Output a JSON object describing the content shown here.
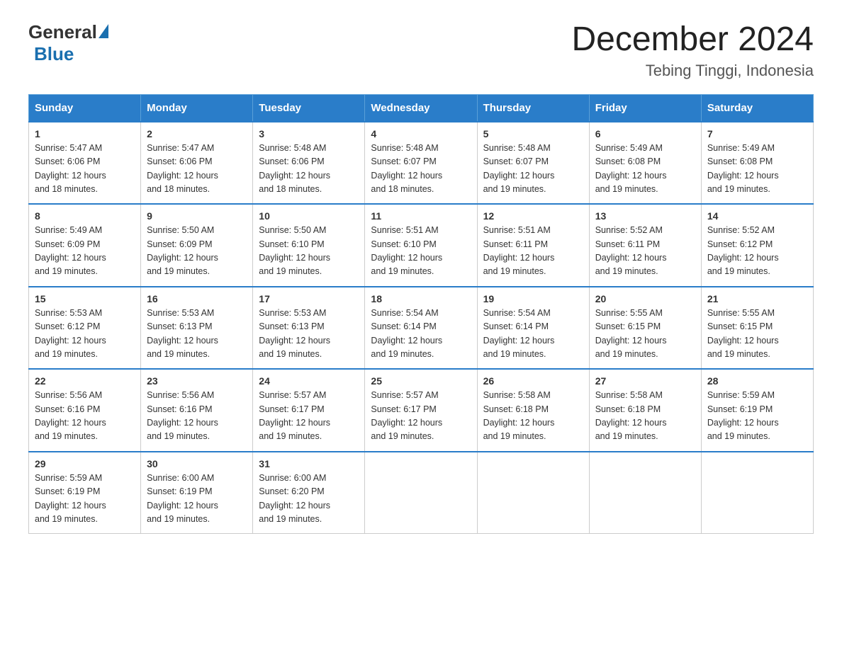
{
  "logo": {
    "general": "General",
    "blue": "Blue"
  },
  "title": "December 2024",
  "subtitle": "Tebing Tinggi, Indonesia",
  "headers": [
    "Sunday",
    "Monday",
    "Tuesday",
    "Wednesday",
    "Thursday",
    "Friday",
    "Saturday"
  ],
  "weeks": [
    [
      {
        "day": "1",
        "sunrise": "5:47 AM",
        "sunset": "6:06 PM",
        "daylight": "12 hours and 18 minutes."
      },
      {
        "day": "2",
        "sunrise": "5:47 AM",
        "sunset": "6:06 PM",
        "daylight": "12 hours and 18 minutes."
      },
      {
        "day": "3",
        "sunrise": "5:48 AM",
        "sunset": "6:06 PM",
        "daylight": "12 hours and 18 minutes."
      },
      {
        "day": "4",
        "sunrise": "5:48 AM",
        "sunset": "6:07 PM",
        "daylight": "12 hours and 18 minutes."
      },
      {
        "day": "5",
        "sunrise": "5:48 AM",
        "sunset": "6:07 PM",
        "daylight": "12 hours and 19 minutes."
      },
      {
        "day": "6",
        "sunrise": "5:49 AM",
        "sunset": "6:08 PM",
        "daylight": "12 hours and 19 minutes."
      },
      {
        "day": "7",
        "sunrise": "5:49 AM",
        "sunset": "6:08 PM",
        "daylight": "12 hours and 19 minutes."
      }
    ],
    [
      {
        "day": "8",
        "sunrise": "5:49 AM",
        "sunset": "6:09 PM",
        "daylight": "12 hours and 19 minutes."
      },
      {
        "day": "9",
        "sunrise": "5:50 AM",
        "sunset": "6:09 PM",
        "daylight": "12 hours and 19 minutes."
      },
      {
        "day": "10",
        "sunrise": "5:50 AM",
        "sunset": "6:10 PM",
        "daylight": "12 hours and 19 minutes."
      },
      {
        "day": "11",
        "sunrise": "5:51 AM",
        "sunset": "6:10 PM",
        "daylight": "12 hours and 19 minutes."
      },
      {
        "day": "12",
        "sunrise": "5:51 AM",
        "sunset": "6:11 PM",
        "daylight": "12 hours and 19 minutes."
      },
      {
        "day": "13",
        "sunrise": "5:52 AM",
        "sunset": "6:11 PM",
        "daylight": "12 hours and 19 minutes."
      },
      {
        "day": "14",
        "sunrise": "5:52 AM",
        "sunset": "6:12 PM",
        "daylight": "12 hours and 19 minutes."
      }
    ],
    [
      {
        "day": "15",
        "sunrise": "5:53 AM",
        "sunset": "6:12 PM",
        "daylight": "12 hours and 19 minutes."
      },
      {
        "day": "16",
        "sunrise": "5:53 AM",
        "sunset": "6:13 PM",
        "daylight": "12 hours and 19 minutes."
      },
      {
        "day": "17",
        "sunrise": "5:53 AM",
        "sunset": "6:13 PM",
        "daylight": "12 hours and 19 minutes."
      },
      {
        "day": "18",
        "sunrise": "5:54 AM",
        "sunset": "6:14 PM",
        "daylight": "12 hours and 19 minutes."
      },
      {
        "day": "19",
        "sunrise": "5:54 AM",
        "sunset": "6:14 PM",
        "daylight": "12 hours and 19 minutes."
      },
      {
        "day": "20",
        "sunrise": "5:55 AM",
        "sunset": "6:15 PM",
        "daylight": "12 hours and 19 minutes."
      },
      {
        "day": "21",
        "sunrise": "5:55 AM",
        "sunset": "6:15 PM",
        "daylight": "12 hours and 19 minutes."
      }
    ],
    [
      {
        "day": "22",
        "sunrise": "5:56 AM",
        "sunset": "6:16 PM",
        "daylight": "12 hours and 19 minutes."
      },
      {
        "day": "23",
        "sunrise": "5:56 AM",
        "sunset": "6:16 PM",
        "daylight": "12 hours and 19 minutes."
      },
      {
        "day": "24",
        "sunrise": "5:57 AM",
        "sunset": "6:17 PM",
        "daylight": "12 hours and 19 minutes."
      },
      {
        "day": "25",
        "sunrise": "5:57 AM",
        "sunset": "6:17 PM",
        "daylight": "12 hours and 19 minutes."
      },
      {
        "day": "26",
        "sunrise": "5:58 AM",
        "sunset": "6:18 PM",
        "daylight": "12 hours and 19 minutes."
      },
      {
        "day": "27",
        "sunrise": "5:58 AM",
        "sunset": "6:18 PM",
        "daylight": "12 hours and 19 minutes."
      },
      {
        "day": "28",
        "sunrise": "5:59 AM",
        "sunset": "6:19 PM",
        "daylight": "12 hours and 19 minutes."
      }
    ],
    [
      {
        "day": "29",
        "sunrise": "5:59 AM",
        "sunset": "6:19 PM",
        "daylight": "12 hours and 19 minutes."
      },
      {
        "day": "30",
        "sunrise": "6:00 AM",
        "sunset": "6:19 PM",
        "daylight": "12 hours and 19 minutes."
      },
      {
        "day": "31",
        "sunrise": "6:00 AM",
        "sunset": "6:20 PM",
        "daylight": "12 hours and 19 minutes."
      },
      null,
      null,
      null,
      null
    ]
  ],
  "labels": {
    "sunrise": "Sunrise:",
    "sunset": "Sunset:",
    "daylight": "Daylight:"
  }
}
